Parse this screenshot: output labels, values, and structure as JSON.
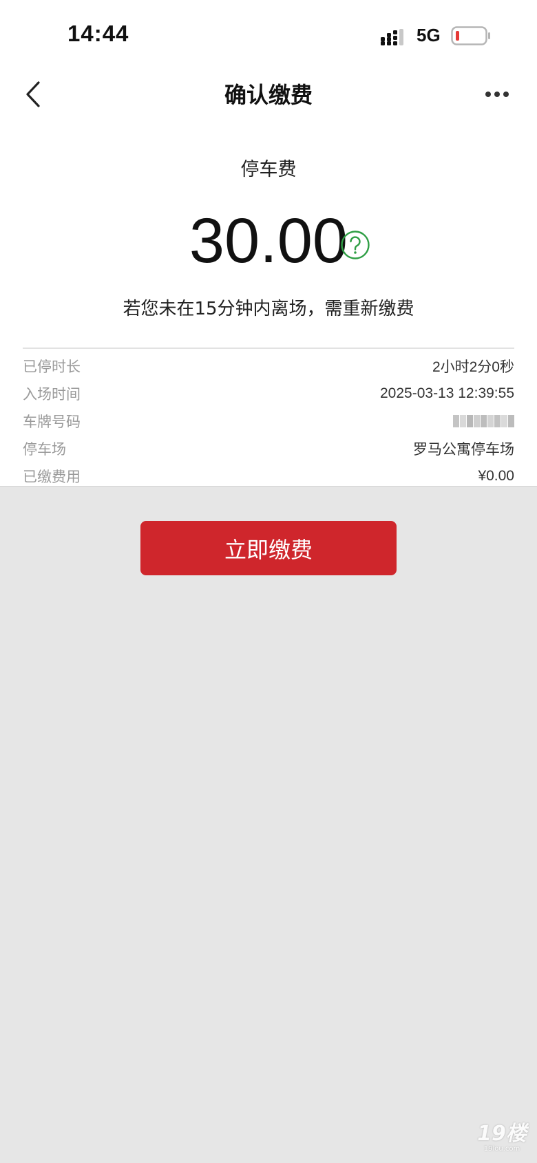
{
  "status_bar": {
    "time": "14:44",
    "network": "5G",
    "signal_icon": "signal-bars-icon",
    "battery_icon": "battery-low-icon",
    "battery_color": "#e53935"
  },
  "nav": {
    "title": "确认缴费",
    "back_icon": "chevron-left-icon",
    "more_icon": "more-dots-icon"
  },
  "fee": {
    "name": "停车费",
    "amount": "30.00",
    "help_icon": "question-circle-icon",
    "help_color": "#2e9e44",
    "notice": "若您未在15分钟内离场，需重新缴费"
  },
  "info": [
    {
      "label": "已停时长",
      "value": "2小时2分0秒"
    },
    {
      "label": "入场时间",
      "value": "2025-03-13 12:39:55"
    },
    {
      "label": "车牌号码",
      "value": ""
    },
    {
      "label": "停车场",
      "value": "罗马公寓停车场"
    },
    {
      "label": "已缴费用",
      "value": "¥0.00"
    }
  ],
  "pay_button": {
    "label": "立即缴费",
    "color": "#cf262c"
  },
  "watermark": {
    "big": "19楼",
    "small": "19lou.com"
  }
}
